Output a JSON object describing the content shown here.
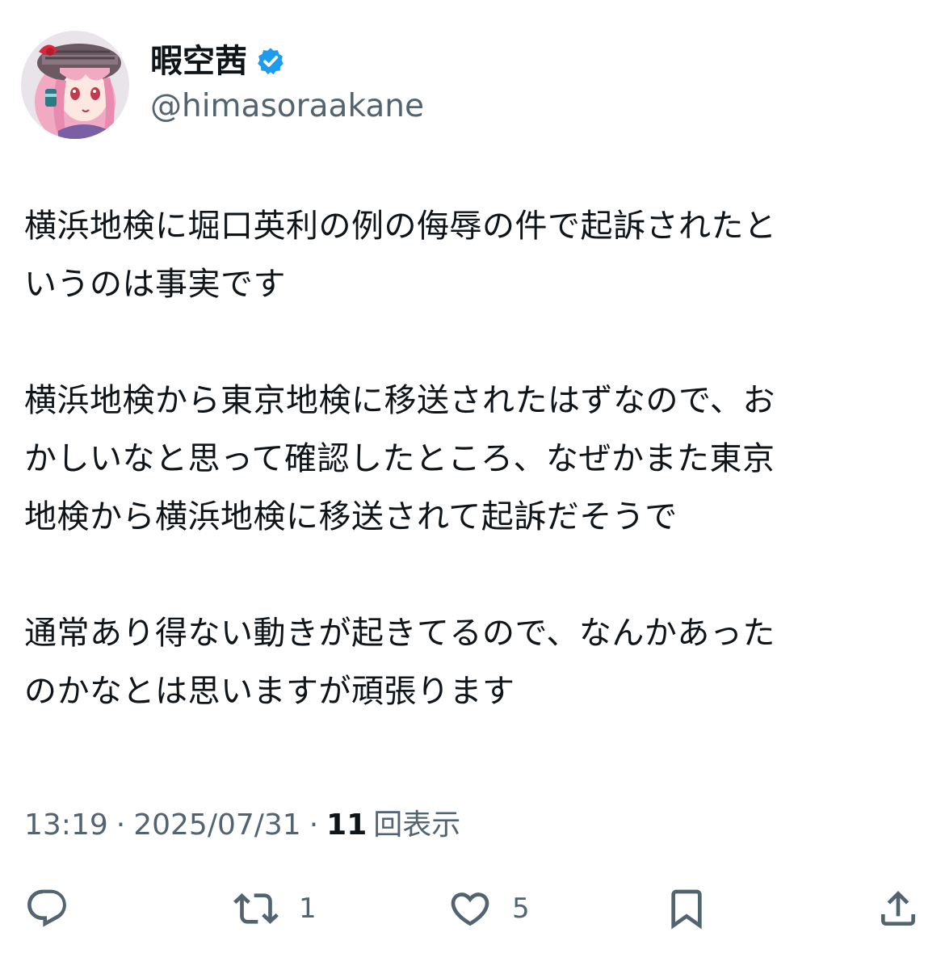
{
  "author": {
    "display_name": "暇空茜",
    "handle": "@himasoraakane",
    "verified": true,
    "avatar_icon": "anime-character-avatar"
  },
  "tweet": {
    "paragraphs": [
      [
        "横浜地検に堀口英利の例の侮辱の件で起訴されたと",
        "いうのは事実です"
      ],
      [
        "横浜地検から東京地検に移送されたはずなので、お",
        "かしいなと思って確認したところ、なぜかまた東京",
        "地検から横浜地検に移送されて起訴だそうで"
      ],
      [
        "通常あり得ない動きが起きてるので、なんかあった",
        "のかなとは思いますが頑張ります"
      ]
    ]
  },
  "meta": {
    "time": "13:19",
    "separator": "·",
    "date": "2025/07/31",
    "views_count": "11",
    "views_label": "回表示"
  },
  "actions": {
    "reply": {
      "icon": "reply-icon",
      "count": ""
    },
    "retweet": {
      "icon": "retweet-icon",
      "count": "1"
    },
    "like": {
      "icon": "heart-icon",
      "count": "5"
    },
    "bookmark": {
      "icon": "bookmark-icon",
      "count": ""
    },
    "share": {
      "icon": "share-icon",
      "count": ""
    }
  },
  "colors": {
    "text_primary": "#0f1419",
    "text_secondary": "#536471",
    "verified_blue": "#1d9bf0",
    "background": "#ffffff"
  }
}
